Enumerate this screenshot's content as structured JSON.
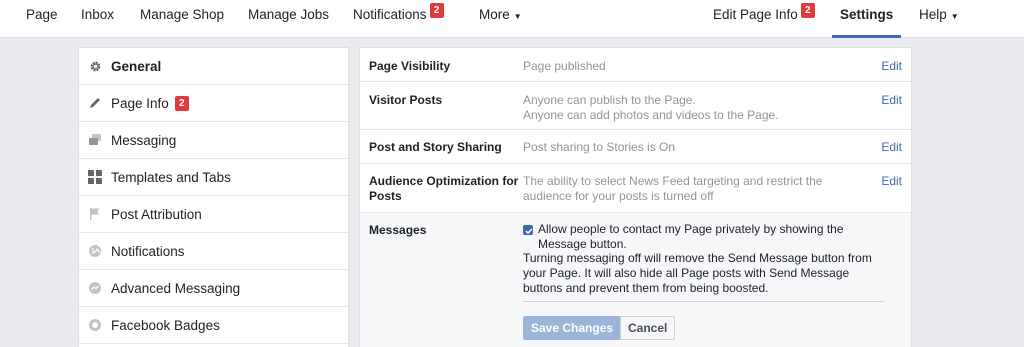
{
  "topnav": {
    "page": "Page",
    "inbox": "Inbox",
    "manage_shop": "Manage Shop",
    "manage_jobs": "Manage Jobs",
    "notifications": "Notifications",
    "notifications_badge": "2",
    "more": "More",
    "edit_page_info": "Edit Page Info",
    "edit_page_info_badge": "2",
    "settings": "Settings",
    "help": "Help"
  },
  "sidebar": {
    "items": [
      {
        "label": "General",
        "icon": "gear-icon"
      },
      {
        "label": "Page Info",
        "icon": "pencil-icon",
        "badge": "2"
      },
      {
        "label": "Messaging",
        "icon": "chat-bubbles-icon"
      },
      {
        "label": "Templates and Tabs",
        "icon": "grid-icon"
      },
      {
        "label": "Post Attribution",
        "icon": "flag-icon"
      },
      {
        "label": "Notifications",
        "icon": "globe-icon"
      },
      {
        "label": "Advanced Messaging",
        "icon": "messenger-icon"
      },
      {
        "label": "Facebook Badges",
        "icon": "badge-icon"
      }
    ]
  },
  "settings": {
    "edit_label": "Edit",
    "page_visibility": {
      "label": "Page Visibility",
      "value": "Page published"
    },
    "visitor_posts": {
      "label": "Visitor Posts",
      "value_line1": "Anyone can publish to the Page.",
      "value_line2": "Anyone can add photos and videos to the Page."
    },
    "post_story_sharing": {
      "label": "Post and Story Sharing",
      "value": "Post sharing to Stories is On"
    },
    "audience_optimization": {
      "label": "Audience Optimization for Posts",
      "value": "The ability to select News Feed targeting and restrict the audience for your posts is turned off"
    },
    "messages": {
      "label": "Messages",
      "checkbox_label": "Allow people to contact my Page privately by showing the Message button.",
      "checked": true,
      "note": "Turning messaging off will remove the Send Message button from your Page. It will also hide all Page posts with Send Message buttons and prevent them from being boosted.",
      "save_label": "Save Changes",
      "cancel_label": "Cancel"
    }
  },
  "colors": {
    "accent": "#4267b2",
    "badge": "#e0393e",
    "background": "#e9ebee",
    "muted_text": "#90949c"
  }
}
